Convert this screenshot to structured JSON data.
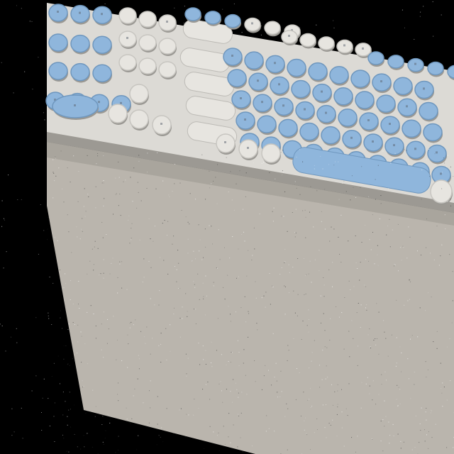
{
  "scene": {
    "subject": "keyboard",
    "colors": {
      "background": "#000000",
      "desk": "#b9b4ac",
      "desk_shadow": "#a9a49c",
      "keyboard_body": "#d9d7d2",
      "keyboard_edge": "#8f8d88",
      "key_white": "#e7e5e0",
      "key_blue": "#8fb6dc",
      "key_blue_dark": "#6f97be",
      "legend": "#5c6470"
    }
  }
}
